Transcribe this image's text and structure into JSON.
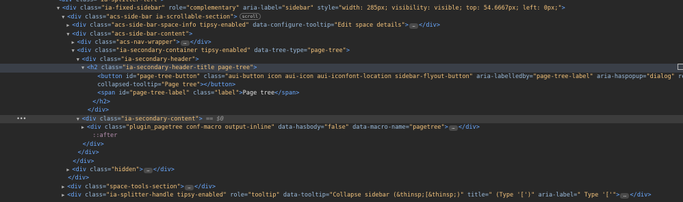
{
  "gutter_marker": "•••",
  "lines": [
    {
      "indent": 9,
      "tri": "",
      "html": "<span class=\"tag\">&lt;div</span> <span class=\"attr\">class=</span><span class=\"val\">\"ia-splitter-left\"</span><span class=\"tag\">&gt;</span>"
    },
    {
      "indent": 10,
      "tri": "▼",
      "html": "<span class=\"tag\">&lt;div</span> <span class=\"attr\">class=</span><span class=\"val\">\"ia-fixed-sidebar\"</span> <span class=\"attr\">role=</span><span class=\"val\">\"complementary\"</span> <span class=\"attr\">aria-label=</span><span class=\"val\">\"sidebar\"</span> <span class=\"attr\">style=</span><span class=\"val\">\"width: 285px; visibility: visible; top: 54.6667px; left: 0px;\"</span><span class=\"tag\">&gt;</span>"
    },
    {
      "indent": 11,
      "tri": "▼",
      "html": "<span class=\"tag\">&lt;div</span> <span class=\"attr\">class=</span><span class=\"val\">\"acs-side-bar ia-scrollable-section\"</span><span class=\"tag\">&gt;</span><span class=\"badge\" data-name=\"scroll-badge\" data-interactable=\"true\">scroll</span>"
    },
    {
      "indent": 12,
      "tri": "▶",
      "html": "<span class=\"tag\">&lt;div</span> <span class=\"attr\">class=</span><span class=\"val\">\"acs-side-bar-space-info tipsy-enabled\"</span> <span class=\"attr\">data-configure-tooltip=</span><span class=\"val\">\"Edit space details\"</span><span class=\"tag\">&gt;</span><span class=\"dots\">…</span><span class=\"tag\">&lt;/div&gt;</span>"
    },
    {
      "indent": 12,
      "tri": "▼",
      "html": "<span class=\"tag\">&lt;div</span> <span class=\"attr\">class=</span><span class=\"val\">\"acs-side-bar-content\"</span><span class=\"tag\">&gt;</span>"
    },
    {
      "indent": 13,
      "tri": "▶",
      "html": "<span class=\"tag\">&lt;div</span> <span class=\"attr\">class=</span><span class=\"val\">\"acs-nav-wrapper\"</span><span class=\"tag\">&gt;</span><span class=\"dots\">…</span><span class=\"tag\">&lt;/div&gt;</span>"
    },
    {
      "indent": 13,
      "tri": "▼",
      "html": "<span class=\"tag\">&lt;div</span> <span class=\"attr\">class=</span><span class=\"val\">\"ia-secondary-container tipsy-enabled\"</span> <span class=\"attr\">data-tree-type=</span><span class=\"val\">\"page-tree\"</span><span class=\"tag\">&gt;</span>"
    },
    {
      "indent": 14,
      "tri": "▼",
      "html": "<span class=\"tag\">&lt;div</span> <span class=\"attr\">class=</span><span class=\"val\">\"ia-secondary-header\"</span><span class=\"tag\">&gt;</span>"
    },
    {
      "indent": 15,
      "tri": "▼",
      "hl": true,
      "html": "<span class=\"tag\">&lt;h2</span> <span class=\"attr\">class=</span><span class=\"val\">\"ia-secondary-header-title page-tree\"</span><span class=\"tag\">&gt;</span>"
    },
    {
      "indent": 17,
      "tri": "",
      "html": "<span class=\"tag\">&lt;button</span> <span class=\"attr\">id=</span><span class=\"val\">\"page-tree-button\"</span> <span class=\"attr\">class=</span><span class=\"val\">\"aui-button icon aui-icon aui-iconfont-location sidebar-flyout-button\"</span> <span class=\"attr\">aria-labelledby=</span><span class=\"val\">\"page-tree-label\"</span> <span class=\"attr\">aria-haspopup=</span><span class=\"val\">\"dialog\"</span> <span class=\"attr\">resolved data-</span>"
    },
    {
      "indent": 17,
      "tri": "",
      "html": "<span class=\"attr\">collapsed-tooltip=</span><span class=\"val\">\"Page tree\"</span><span class=\"tag\">&gt;&lt;/button&gt;</span>"
    },
    {
      "indent": 17,
      "tri": "",
      "html": "<span class=\"tag\">&lt;span</span> <span class=\"attr\">id=</span><span class=\"val\">\"page-tree-label\"</span> <span class=\"attr\">class=</span><span class=\"val\">\"label\"</span><span class=\"tag\">&gt;</span><span class=\"txt\">Page tree</span><span class=\"tag\">&lt;/span&gt;</span>"
    },
    {
      "indent": 16,
      "tri": "",
      "html": "<span class=\"tag\">&lt;/h2&gt;</span>"
    },
    {
      "indent": 15,
      "tri": "",
      "html": "<span class=\"tag\">&lt;/div&gt;</span>"
    },
    {
      "indent": 14,
      "tri": "▼",
      "sel": true,
      "html": "<span class=\"tag\">&lt;div</span> <span class=\"attr\">class=</span><span class=\"val\">\"ia-secondary-content\"</span><span class=\"tag\">&gt;</span> <span class=\"eq\">== $0</span>"
    },
    {
      "indent": 15,
      "tri": "▶",
      "html": "<span class=\"tag\">&lt;div</span> <span class=\"attr\">class=</span><span class=\"val\">\"plugin_pagetree conf-macro output-inline\"</span> <span class=\"attr\">data-hasbody=</span><span class=\"val\">\"false\"</span> <span class=\"attr\">data-macro-name=</span><span class=\"val\">\"pagetree\"</span><span class=\"tag\">&gt;</span><span class=\"dots\">…</span><span class=\"tag\">&lt;/div&gt;</span>"
    },
    {
      "indent": 16,
      "tri": "",
      "html": "<span class=\"pseudo\">::after</span>"
    },
    {
      "indent": 14,
      "tri": "",
      "html": "<span class=\"tag\">&lt;/div&gt;</span>"
    },
    {
      "indent": 13,
      "tri": "",
      "html": "<span class=\"tag\">&lt;/div&gt;</span>"
    },
    {
      "indent": 12,
      "tri": "",
      "html": "<span class=\"tag\">&lt;/div&gt;</span>"
    },
    {
      "indent": 12,
      "tri": "▶",
      "html": "<span class=\"tag\">&lt;div</span> <span class=\"attr\">class=</span><span class=\"val\">\"hidden\"</span><span class=\"tag\">&gt;</span><span class=\"dots\">…</span><span class=\"tag\">&lt;/div&gt;</span>"
    },
    {
      "indent": 11,
      "tri": "",
      "html": "<span class=\"tag\">&lt;/div&gt;</span>"
    },
    {
      "indent": 11,
      "tri": "▶",
      "html": "<span class=\"tag\">&lt;div</span> <span class=\"attr\">class=</span><span class=\"val\">\"space-tools-section\"</span><span class=\"tag\">&gt;</span><span class=\"dots\">…</span><span class=\"tag\">&lt;/div&gt;</span>"
    },
    {
      "indent": 11,
      "tri": "▶",
      "html": "<span class=\"tag\">&lt;div</span> <span class=\"attr\">class=</span><span class=\"val\">\"ia-splitter-handle tipsy-enabled\"</span> <span class=\"attr\">role=</span><span class=\"val\">\"tooltip\"</span> <span class=\"attr\">data-tooltip=</span><span class=\"val\">\"Collapse sidebar (&amp;thinsp;[&amp;thinsp;)\"</span> <span class=\"attr\">title=</span><span class=\"val\">\" (Type '[')\"</span> <span class=\"attr\">aria-label=</span><span class=\"val\">\" Type '['\"</span><span class=\"tag\">&gt;</span><span class=\"dots\">…</span><span class=\"tag\">&lt;/div&gt;</span>"
    }
  ]
}
